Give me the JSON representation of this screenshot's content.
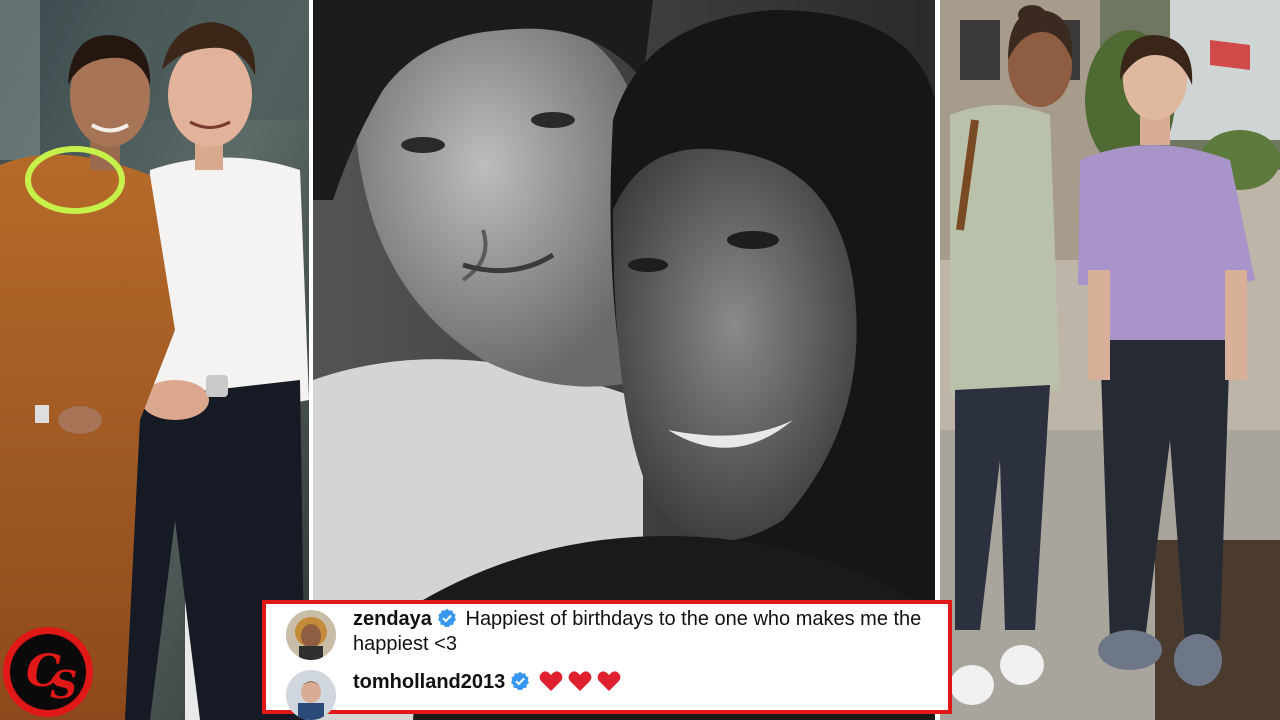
{
  "logo": {
    "text": "CS",
    "colors": {
      "ring": "#e01818",
      "background": "#0a0a0a",
      "letter": "#e01818"
    }
  },
  "comments": [
    {
      "username": "zendaya",
      "verified": true,
      "text": "Happiest of birthdays to the one who makes me the happiest <3",
      "avatar_icon": "profile-photo"
    },
    {
      "username": "tomholland2013",
      "verified": true,
      "text": "",
      "emoji": [
        "red-heart",
        "red-heart",
        "red-heart"
      ],
      "avatar_icon": "profile-photo"
    }
  ],
  "colors": {
    "comment_border": "#e01818",
    "verified_badge": "#3897f0",
    "heart": "#e0202e"
  }
}
